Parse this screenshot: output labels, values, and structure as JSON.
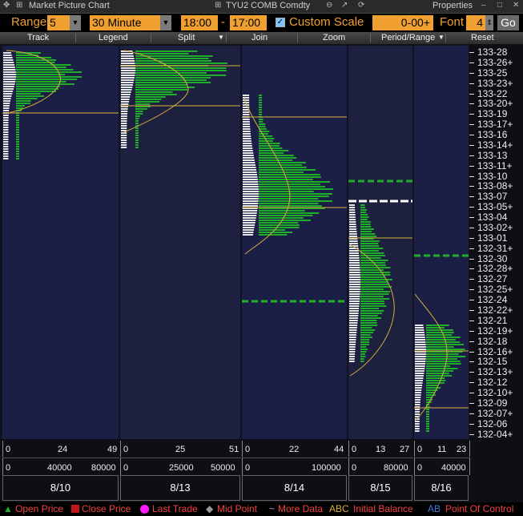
{
  "window": {
    "title": "Market Picture Chart",
    "ticker": "TYU2 COMB Comdty",
    "properties": "Properties"
  },
  "toolbar": {
    "range_label": "Range",
    "range_value": "5",
    "interval_value": "30 Minute",
    "time_start": "18:00",
    "dash": "-",
    "time_end": "17:00",
    "custom_scale_label": "Custom Scale",
    "custom_scale_value": "0-00+",
    "font_label": "Font",
    "font_value": "4",
    "go_label": "Go"
  },
  "menu": {
    "track": "Track",
    "legend": "Legend",
    "split": "Split",
    "join": "Join",
    "zoom": "Zoom",
    "period_range": "Period/Range",
    "reset": "Reset"
  },
  "y_axis_labels": [
    "133-28",
    "133-26+",
    "133-25",
    "133-23+",
    "133-22",
    "133-20+",
    "133-19",
    "133-17+",
    "133-16",
    "133-14+",
    "133-13",
    "133-11+",
    "133-10",
    "133-08+",
    "133-07",
    "133-05+",
    "133-04",
    "133-02+",
    "133-01",
    "132-31+",
    "132-30",
    "132-28+",
    "132-27",
    "132-25+",
    "132-24",
    "132-22+",
    "132-21",
    "132-19+",
    "132-18",
    "132-16+",
    "132-15",
    "132-13+",
    "132-12",
    "132-10+",
    "132-09",
    "132-07+",
    "132-06",
    "132-04+"
  ],
  "sessions": [
    {
      "date": "8/10",
      "tpo_axis": [
        "0",
        "24",
        "49"
      ],
      "vol_axis": [
        "0",
        "40000",
        "80000"
      ]
    },
    {
      "date": "8/13",
      "tpo_axis": [
        "0",
        "25",
        "51"
      ],
      "vol_axis": [
        "0",
        "25000",
        "50000"
      ]
    },
    {
      "date": "8/14",
      "tpo_axis": [
        "0",
        "22",
        "44"
      ],
      "vol_axis": [
        "0",
        "100000"
      ]
    },
    {
      "date": "8/15",
      "tpo_axis": [
        "0",
        "13",
        "27"
      ],
      "vol_axis": [
        "0",
        "80000"
      ]
    },
    {
      "date": "8/16",
      "tpo_axis": [
        "0",
        "11",
        "23"
      ],
      "vol_axis": [
        "0",
        "40000"
      ]
    }
  ],
  "legend": {
    "open_price": "Open Price",
    "close_price": "Close Price",
    "last_trade": "Last Trade",
    "mid_point": "Mid Point",
    "more_data": "More Data",
    "initial_balance_abc": "ABC",
    "initial_balance": "Initial Balance",
    "point_of_control_ab": "AB",
    "point_of_control": "Point Of Control"
  },
  "colors": {
    "panel_bg": "#1c1f45",
    "volume_bar": "#1fae2a",
    "value_area_line": "#d9b03a",
    "accent_orange": "#f0a030",
    "ib_dash": "#1fae2a"
  }
}
